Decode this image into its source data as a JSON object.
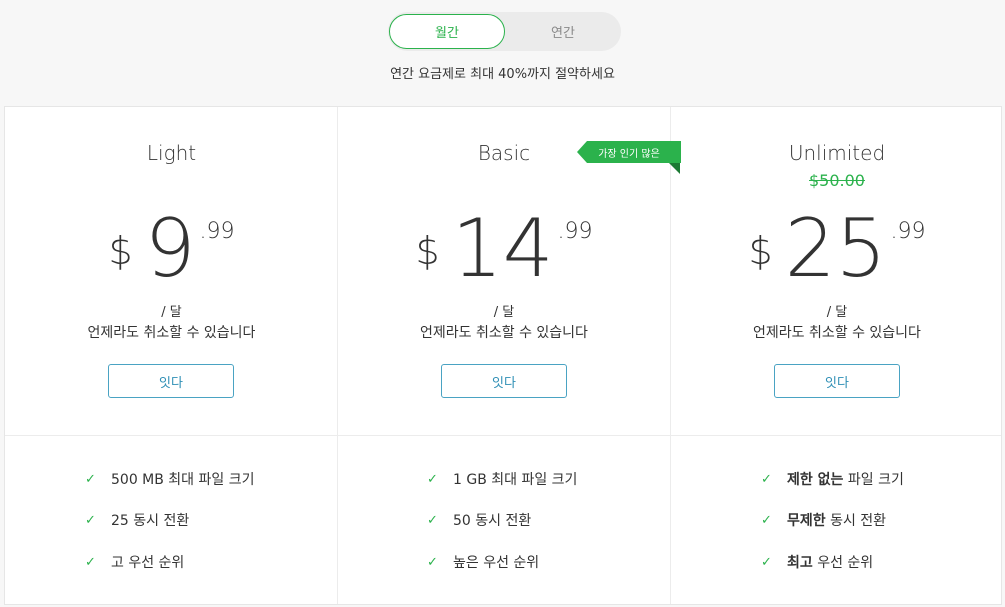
{
  "toggle": {
    "monthly": "월간",
    "yearly": "연간"
  },
  "save_note": "연간 요금제로 최대 40%까지 절약하세요",
  "ribbon": "가장 인기 많은",
  "plans": [
    {
      "name": "Light",
      "old_price": "",
      "currency": "$",
      "main": "9",
      "cents": ".99",
      "per": "/ 달",
      "cancel": "언제라도 취소할 수 있습니다",
      "button": "잇다",
      "features": [
        "500 MB 최대 파일 크기",
        "25 동시 전환",
        "고 우선 순위"
      ]
    },
    {
      "name": "Basic",
      "old_price": "",
      "currency": "$",
      "main": "14",
      "cents": ".99",
      "per": "/ 달",
      "cancel": "언제라도 취소할 수 있습니다",
      "button": "잇다",
      "features": [
        "1 GB 최대 파일 크기",
        "50 동시 전환",
        "높은 우선 순위"
      ]
    },
    {
      "name": "Unlimited",
      "old_price": "$50.00",
      "currency": "$",
      "main": "25",
      "cents": ".99",
      "per": "/ 달",
      "cancel": "언제라도 취소할 수 있습니다",
      "button": "잇다",
      "features": [
        {
          "bold": "제한 없는",
          "rest": " 파일 크기"
        },
        {
          "bold": "무제한",
          "rest": " 동시 전환"
        },
        {
          "bold": "최고",
          "rest": " 우선 순위"
        }
      ]
    }
  ],
  "colors": {
    "accent": "#2bb24c",
    "button_border": "#4aa3c3",
    "ribbon_fold": "#1c7a34"
  }
}
